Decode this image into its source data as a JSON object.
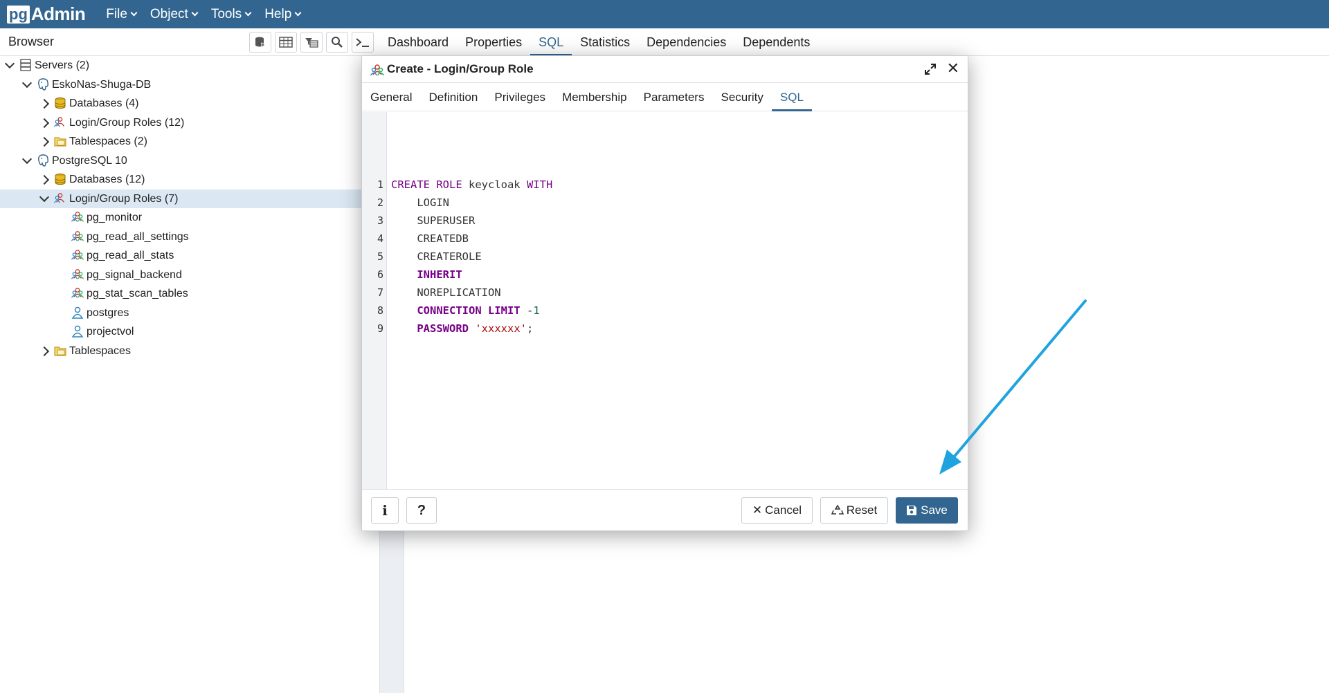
{
  "navbar": {
    "brand_pg": "pg",
    "brand_admin": "Admin",
    "menus": [
      "File",
      "Object",
      "Tools",
      "Help"
    ]
  },
  "browser": {
    "title": "Browser",
    "tools": [
      "database-icon",
      "table-icon",
      "filter-table-icon",
      "search-icon",
      "terminal-icon"
    ]
  },
  "tree": [
    {
      "label": "Servers (2)",
      "icon": "servers-icon",
      "depth": 0,
      "toggle": "open"
    },
    {
      "label": "EskoNas-Shuga-DB",
      "icon": "postgres-server-icon",
      "depth": 1,
      "toggle": "open"
    },
    {
      "label": "Databases (4)",
      "icon": "databases-icon",
      "depth": 2,
      "toggle": "closed"
    },
    {
      "label": "Login/Group Roles (12)",
      "icon": "roles-icon",
      "depth": 2,
      "toggle": "closed"
    },
    {
      "label": "Tablespaces (2)",
      "icon": "tablespaces-icon",
      "depth": 2,
      "toggle": "closed"
    },
    {
      "label": "PostgreSQL 10",
      "icon": "postgres-server-icon",
      "depth": 1,
      "toggle": "open"
    },
    {
      "label": "Databases (12)",
      "icon": "databases-icon",
      "depth": 2,
      "toggle": "closed"
    },
    {
      "label": "Login/Group Roles (7)",
      "icon": "roles-icon",
      "depth": 2,
      "toggle": "open",
      "selected": true
    },
    {
      "label": "pg_monitor",
      "icon": "group-role-icon",
      "depth": 3,
      "toggle": "none"
    },
    {
      "label": "pg_read_all_settings",
      "icon": "group-role-icon",
      "depth": 3,
      "toggle": "none"
    },
    {
      "label": "pg_read_all_stats",
      "icon": "group-role-icon",
      "depth": 3,
      "toggle": "none"
    },
    {
      "label": "pg_signal_backend",
      "icon": "group-role-icon",
      "depth": 3,
      "toggle": "none"
    },
    {
      "label": "pg_stat_scan_tables",
      "icon": "group-role-icon",
      "depth": 3,
      "toggle": "none"
    },
    {
      "label": "postgres",
      "icon": "user-role-icon",
      "depth": 3,
      "toggle": "none"
    },
    {
      "label": "projectvol",
      "icon": "user-role-icon",
      "depth": 3,
      "toggle": "none"
    },
    {
      "label": "Tablespaces",
      "icon": "tablespaces-icon",
      "depth": 2,
      "toggle": "closed"
    }
  ],
  "main_tabs": {
    "items": [
      "Dashboard",
      "Properties",
      "SQL",
      "Statistics",
      "Dependencies",
      "Dependents"
    ],
    "active": "SQL"
  },
  "dialog": {
    "title": "Create - Login/Group Role",
    "tabs": [
      "General",
      "Definition",
      "Privileges",
      "Membership",
      "Parameters",
      "Security",
      "SQL"
    ],
    "active_tab": "SQL",
    "sql_lines": [
      [
        {
          "t": "CREATE ROLE",
          "c": "kw"
        },
        {
          "t": " keycloak ",
          "c": ""
        },
        {
          "t": "WITH",
          "c": "kw"
        }
      ],
      [
        {
          "t": "    LOGIN",
          "c": ""
        }
      ],
      [
        {
          "t": "    SUPERUSER",
          "c": ""
        }
      ],
      [
        {
          "t": "    CREATEDB",
          "c": ""
        }
      ],
      [
        {
          "t": "    CREATEROLE",
          "c": ""
        }
      ],
      [
        {
          "t": "    ",
          "c": ""
        },
        {
          "t": "INHERIT",
          "c": "kwb"
        }
      ],
      [
        {
          "t": "    NOREPLICATION",
          "c": ""
        }
      ],
      [
        {
          "t": "    ",
          "c": ""
        },
        {
          "t": "CONNECTION LIMIT",
          "c": "kwb"
        },
        {
          "t": " -",
          "c": ""
        },
        {
          "t": "1",
          "c": "num"
        }
      ],
      [
        {
          "t": "    ",
          "c": ""
        },
        {
          "t": "PASSWORD",
          "c": "kwb"
        },
        {
          "t": " ",
          "c": ""
        },
        {
          "t": "'xxxxxx'",
          "c": "str"
        },
        {
          "t": ";",
          "c": ""
        }
      ]
    ],
    "buttons": {
      "info": "i",
      "help": "?",
      "cancel": "Cancel",
      "reset": "Reset",
      "save": "Save"
    }
  },
  "colors": {
    "navbar": "#326690",
    "accent": "#326690",
    "selected_row": "#dbe8f3",
    "arrow": "#1fa3df"
  }
}
